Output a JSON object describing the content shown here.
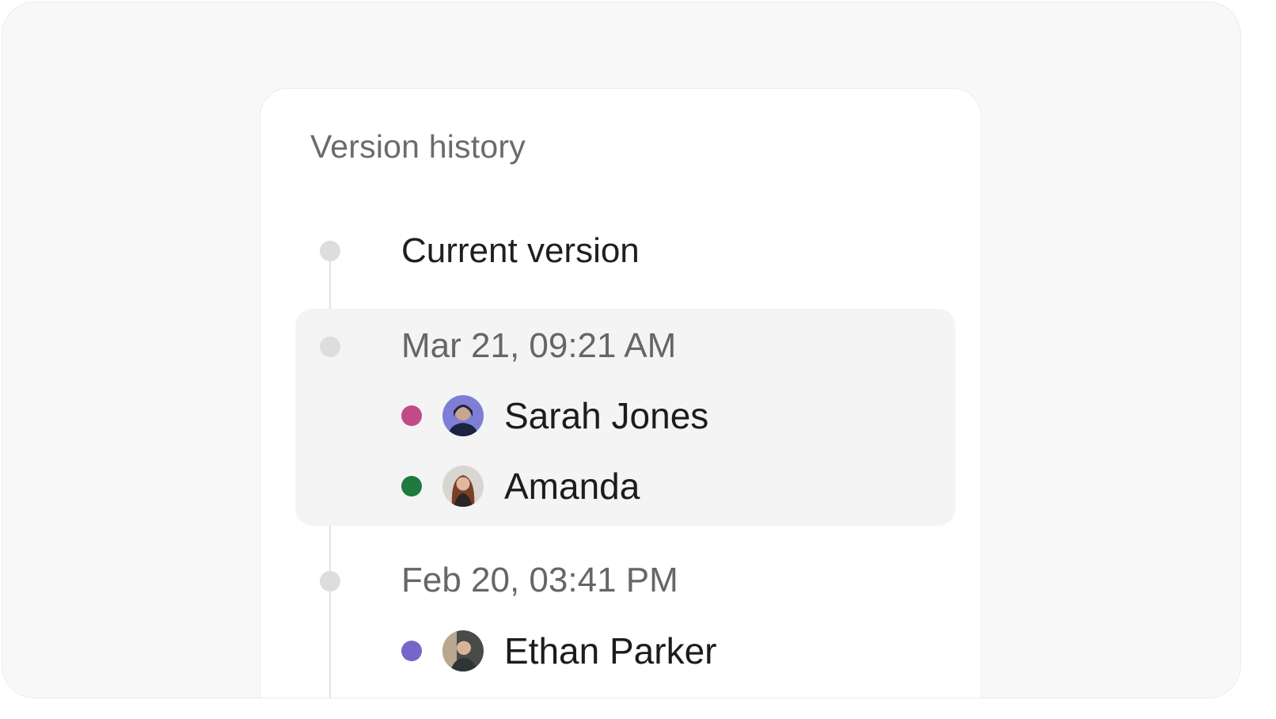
{
  "panel": {
    "title": "Version history"
  },
  "versions": [
    {
      "label": "Current version"
    },
    {
      "label": "Mar 21, 09:21 AM",
      "users": [
        {
          "name": "Sarah Jones",
          "color": "#c14b86",
          "avatar": "sarah-avatar"
        },
        {
          "name": "Amanda",
          "color": "#1e7a3e",
          "avatar": "amanda-avatar"
        }
      ]
    },
    {
      "label": "Feb 20, 03:41 PM",
      "users": [
        {
          "name": "Ethan Parker",
          "color": "#7567c8",
          "avatar": "ethan-avatar"
        }
      ]
    }
  ],
  "colors": {
    "highlight_bg": "#f4f4f4",
    "node": "#dddddd"
  }
}
